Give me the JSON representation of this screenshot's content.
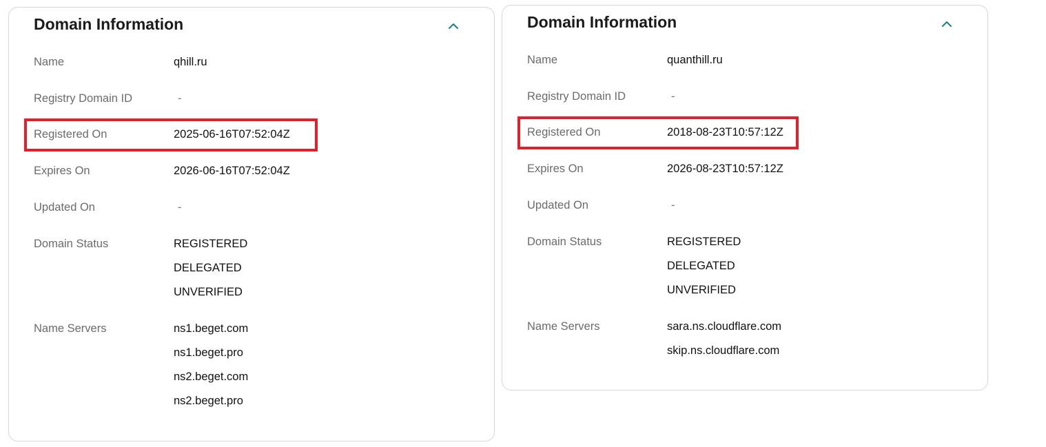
{
  "cards": [
    {
      "title": "Domain Information",
      "rows": {
        "name": {
          "label": "Name",
          "value": "qhill.ru"
        },
        "registry_domain_id": {
          "label": "Registry Domain ID",
          "value": "-"
        },
        "registered_on": {
          "label": "Registered On",
          "value": "2025-06-16T07:52:04Z"
        },
        "expires_on": {
          "label": "Expires On",
          "value": "2026-06-16T07:52:04Z"
        },
        "updated_on": {
          "label": "Updated On",
          "value": "-"
        },
        "domain_status": {
          "label": "Domain Status",
          "values": [
            "REGISTERED",
            "DELEGATED",
            "UNVERIFIED"
          ]
        },
        "name_servers": {
          "label": "Name Servers",
          "values": [
            "ns1.beget.com",
            "ns1.beget.pro",
            "ns2.beget.com",
            "ns2.beget.pro"
          ]
        }
      }
    },
    {
      "title": "Domain Information",
      "rows": {
        "name": {
          "label": "Name",
          "value": "quanthill.ru"
        },
        "registry_domain_id": {
          "label": "Registry Domain ID",
          "value": "-"
        },
        "registered_on": {
          "label": "Registered On",
          "value": "2018-08-23T10:57:12Z"
        },
        "expires_on": {
          "label": "Expires On",
          "value": "2026-08-23T10:57:12Z"
        },
        "updated_on": {
          "label": "Updated On",
          "value": "-"
        },
        "domain_status": {
          "label": "Domain Status",
          "values": [
            "REGISTERED",
            "DELEGATED",
            "UNVERIFIED"
          ]
        },
        "name_servers": {
          "label": "Name Servers",
          "values": [
            "sara.ns.cloudflare.com",
            "skip.ns.cloudflare.com"
          ]
        }
      }
    }
  ],
  "icons": {
    "collapse": "chevron-up-icon"
  },
  "colors": {
    "highlight": "#e41e2b",
    "chevron": "#1b7f86",
    "label": "#6b6b6b",
    "value": "#111111"
  }
}
